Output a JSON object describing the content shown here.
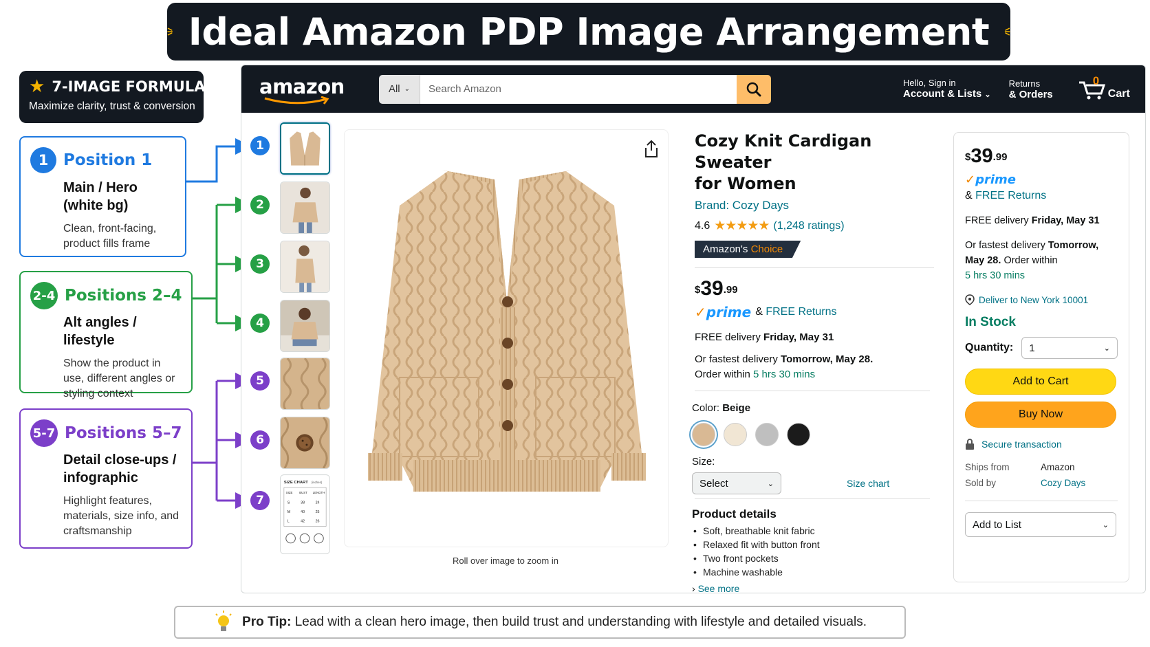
{
  "banner": {
    "title": "Ideal Amazon PDP Image Arrangement"
  },
  "formula": {
    "title": "7-IMAGE FORMULA",
    "subtitle": "Maximize clarity, trust & conversion"
  },
  "positions": [
    {
      "badge": "1",
      "title": "Position 1",
      "subtitle": "Main / Hero (white bg)",
      "description": "Clean, front-facing, product fills frame",
      "color": "#1f7ae0"
    },
    {
      "badge": "2-4",
      "title": "Positions 2–4",
      "subtitle": "Alt angles / lifestyle",
      "description": "Show the product in use, different angles or styling context",
      "color": "#26a046"
    },
    {
      "badge": "5-7",
      "title": "Positions 5–7",
      "subtitle": "Detail close-ups / infographic",
      "description": "Highlight features, materials, size info, and craftsmanship",
      "color": "#7c3fc9"
    }
  ],
  "thumb_badges": [
    "1",
    "2",
    "3",
    "4",
    "5",
    "6",
    "7"
  ],
  "nav": {
    "logo": "amazon",
    "search_category": "All",
    "search_placeholder": "Search Amazon",
    "account_line1": "Hello, Sign in",
    "account_line2": "Account & Lists",
    "returns_line1": "Returns",
    "returns_line2": "& Orders",
    "cart_count": "0",
    "cart_label": "Cart"
  },
  "size_chart_thumb": {
    "title": "SIZE CHART",
    "unit": "(inches)",
    "headers": [
      "SIZE",
      "BUST",
      "LENGTH"
    ],
    "rows": [
      [
        "S",
        "38",
        "24"
      ],
      [
        "M",
        "40",
        "25"
      ],
      [
        "L",
        "42",
        "26"
      ]
    ]
  },
  "main_image": {
    "caption": "Roll over image to zoom in"
  },
  "product": {
    "title_line1": "Cozy Knit Cardigan Sweater",
    "title_line2": "for Women",
    "brand": "Brand: Cozy Days",
    "rating": "4.6",
    "stars": "★★★★★",
    "ratings_count": "(1,248 ratings)",
    "choice_label": "Amazon's",
    "choice_highlight": "Choice",
    "price_symbol": "$",
    "price_whole": "39",
    "price_fraction": ".99",
    "prime": "prime",
    "free_returns": "& FREE Returns",
    "free_returns_link": "FREE Returns",
    "delivery_prefix": "FREE delivery",
    "delivery_date": "Friday, May 31",
    "fastest_prefix": "Or fastest delivery",
    "fastest_date": "Tomorrow, May 28.",
    "order_within": "Order within",
    "time_left": "5 hrs 30 mins",
    "color_label": "Color:",
    "color_value": "Beige",
    "colors": [
      "#d9b994",
      "#f1e6d4",
      "#bfbfbf",
      "#1b1b1b"
    ],
    "size_label": "Size:",
    "size_value": "Select",
    "size_chart": "Size chart",
    "details_title": "Product details",
    "details": [
      "Soft, breathable knit fabric",
      "Relaxed fit with button front",
      "Two front pockets",
      "Machine washable"
    ],
    "see_more": "See more"
  },
  "buybox": {
    "price_symbol": "$",
    "price_whole": "39",
    "price_fraction": ".99",
    "prime": "prime",
    "free_returns_amp": "&",
    "free_returns": "FREE Returns",
    "delivery_prefix": "FREE delivery",
    "delivery_date": "Friday, May 31",
    "fastest_prefix": "Or fastest delivery",
    "fastest_date_1": "Tomorrow,",
    "fastest_date_2": "May 28.",
    "order_within": "Order within",
    "time_left": "5 hrs 30 mins",
    "deliver_to": "Deliver to New York 10001",
    "stock": "In Stock",
    "quantity_label": "Quantity:",
    "quantity_value": "1",
    "add_to_cart": "Add to Cart",
    "buy_now": "Buy Now",
    "secure": "Secure transaction",
    "ships_from_label": "Ships from",
    "ships_from_value": "Amazon",
    "sold_by_label": "Sold by",
    "sold_by_value": "Cozy Days",
    "add_to_list": "Add to List"
  },
  "protip": {
    "label": "Pro Tip:",
    "text": "Lead with a clean hero image, then build trust and understanding with lifestyle and detailed visuals."
  }
}
